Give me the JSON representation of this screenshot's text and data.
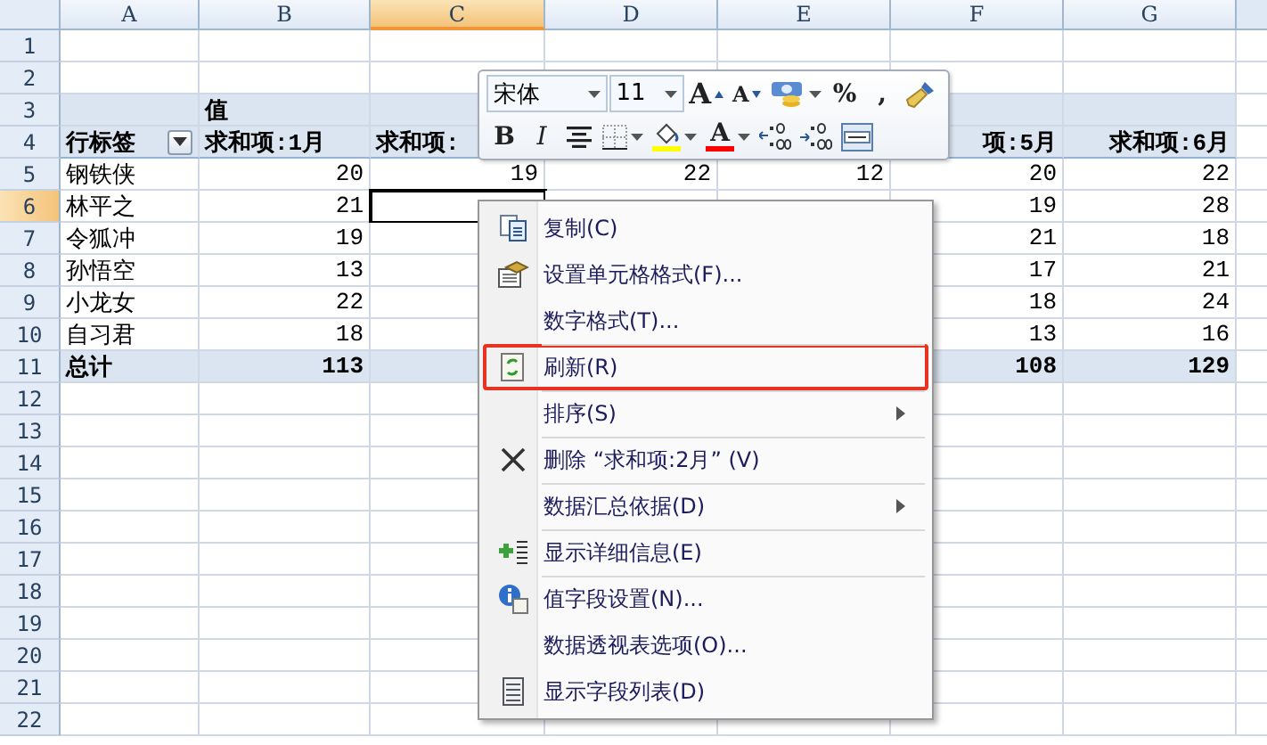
{
  "sheet": {
    "columns": [
      {
        "label": "A",
        "selected": false
      },
      {
        "label": "B",
        "selected": false
      },
      {
        "label": "C",
        "selected": true
      },
      {
        "label": "D",
        "selected": false
      },
      {
        "label": "E",
        "selected": false
      },
      {
        "label": "F",
        "selected": false
      },
      {
        "label": "G",
        "selected": false
      }
    ],
    "rows": [
      {
        "number": "1",
        "selected": false,
        "kind": "blank"
      },
      {
        "number": "2",
        "selected": false,
        "kind": "blank"
      },
      {
        "number": "3",
        "selected": false,
        "kind": "pivot-header",
        "cells": {
          "B": "值"
        }
      },
      {
        "number": "4",
        "selected": false,
        "kind": "pivot-header",
        "filter_button": true,
        "cells": {
          "A": "行标签",
          "B": "求和项:1月",
          "C": "求和项:",
          "F": "项:5月",
          "G": "求和项:6月"
        }
      },
      {
        "number": "5",
        "selected": false,
        "kind": "body",
        "cells": {
          "A": "钢铁侠",
          "B": "20",
          "C": "19",
          "D": "22",
          "E": "12",
          "F": "20",
          "G": "22"
        }
      },
      {
        "number": "6",
        "selected": true,
        "kind": "body",
        "cells": {
          "A": "林平之",
          "B": "21",
          "F": "19",
          "G": "28"
        }
      },
      {
        "number": "7",
        "selected": false,
        "kind": "body",
        "cells": {
          "A": "令狐冲",
          "B": "19",
          "F": "21",
          "G": "18"
        }
      },
      {
        "number": "8",
        "selected": false,
        "kind": "body",
        "cells": {
          "A": "孙悟空",
          "B": "13",
          "F": "17",
          "G": "21"
        }
      },
      {
        "number": "9",
        "selected": false,
        "kind": "body",
        "cells": {
          "A": "小龙女",
          "B": "22",
          "F": "18",
          "G": "24"
        }
      },
      {
        "number": "10",
        "selected": false,
        "kind": "body",
        "cells": {
          "A": "自习君",
          "B": "18",
          "F": "13",
          "G": "16"
        }
      },
      {
        "number": "11",
        "selected": false,
        "kind": "total",
        "cells": {
          "A": "总计",
          "B": "113",
          "F": "108",
          "G": "129"
        }
      },
      {
        "number": "12",
        "selected": false,
        "kind": "blank"
      },
      {
        "number": "13",
        "selected": false,
        "kind": "blank"
      },
      {
        "number": "14",
        "selected": false,
        "kind": "blank"
      },
      {
        "number": "15",
        "selected": false,
        "kind": "blank"
      },
      {
        "number": "16",
        "selected": false,
        "kind": "blank"
      },
      {
        "number": "17",
        "selected": false,
        "kind": "blank"
      },
      {
        "number": "18",
        "selected": false,
        "kind": "blank"
      },
      {
        "number": "19",
        "selected": false,
        "kind": "blank"
      },
      {
        "number": "20",
        "selected": false,
        "kind": "blank"
      },
      {
        "number": "21",
        "selected": false,
        "kind": "blank"
      },
      {
        "number": "22",
        "selected": false,
        "kind": "blank"
      }
    ]
  },
  "mini_toolbar": {
    "font": "宋体",
    "size": "11",
    "top_buttons": [
      {
        "kind": "grow-font",
        "text": "A"
      },
      {
        "kind": "shrink-font",
        "text": "A"
      },
      {
        "kind": "accounting"
      },
      {
        "kind": "glyph",
        "text": "%"
      },
      {
        "kind": "glyph",
        "text": ","
      },
      {
        "kind": "format-painter"
      }
    ],
    "bottom_buttons": [
      {
        "kind": "bold",
        "text": "B"
      },
      {
        "kind": "italic",
        "text": "I"
      },
      {
        "kind": "center"
      },
      {
        "kind": "borders"
      },
      {
        "kind": "fill-color",
        "color": "#ffff00"
      },
      {
        "kind": "font-color",
        "text": "A",
        "color": "#ff0000"
      },
      {
        "kind": "increase-decimal"
      },
      {
        "kind": "decrease-decimal"
      },
      {
        "kind": "merge"
      }
    ]
  },
  "context_menu": {
    "items": [
      {
        "kind": "copy",
        "label": "复制(C)",
        "separator_before": false,
        "submenu": false,
        "highlighted": false
      },
      {
        "kind": "format-cells",
        "label": "设置单元格格式(F)...",
        "separator_before": false,
        "submenu": false,
        "highlighted": false
      },
      {
        "kind": "plain",
        "label": "数字格式(T)...",
        "separator_before": false,
        "submenu": false,
        "highlighted": false
      },
      {
        "kind": "refresh",
        "label": "刷新(R)",
        "separator_before": true,
        "submenu": false,
        "highlighted": true
      },
      {
        "kind": "plain",
        "label": "排序(S)",
        "separator_before": true,
        "submenu": true,
        "highlighted": false
      },
      {
        "kind": "delete",
        "label": "删除 “求和项:2月” (V)",
        "separator_before": true,
        "submenu": false,
        "highlighted": false
      },
      {
        "kind": "plain",
        "label": "数据汇总依据(D)",
        "separator_before": true,
        "submenu": true,
        "highlighted": false
      },
      {
        "kind": "show-detail",
        "label": "显示详细信息(E)",
        "separator_before": true,
        "submenu": false,
        "highlighted": false
      },
      {
        "kind": "field-settings",
        "label": "值字段设置(N)...",
        "separator_before": true,
        "submenu": false,
        "highlighted": false
      },
      {
        "kind": "plain",
        "label": "数据透视表选项(O)...",
        "separator_before": false,
        "submenu": false,
        "highlighted": false
      },
      {
        "kind": "field-list",
        "label": "显示字段列表(D)",
        "separator_before": false,
        "submenu": false,
        "highlighted": false
      }
    ]
  }
}
